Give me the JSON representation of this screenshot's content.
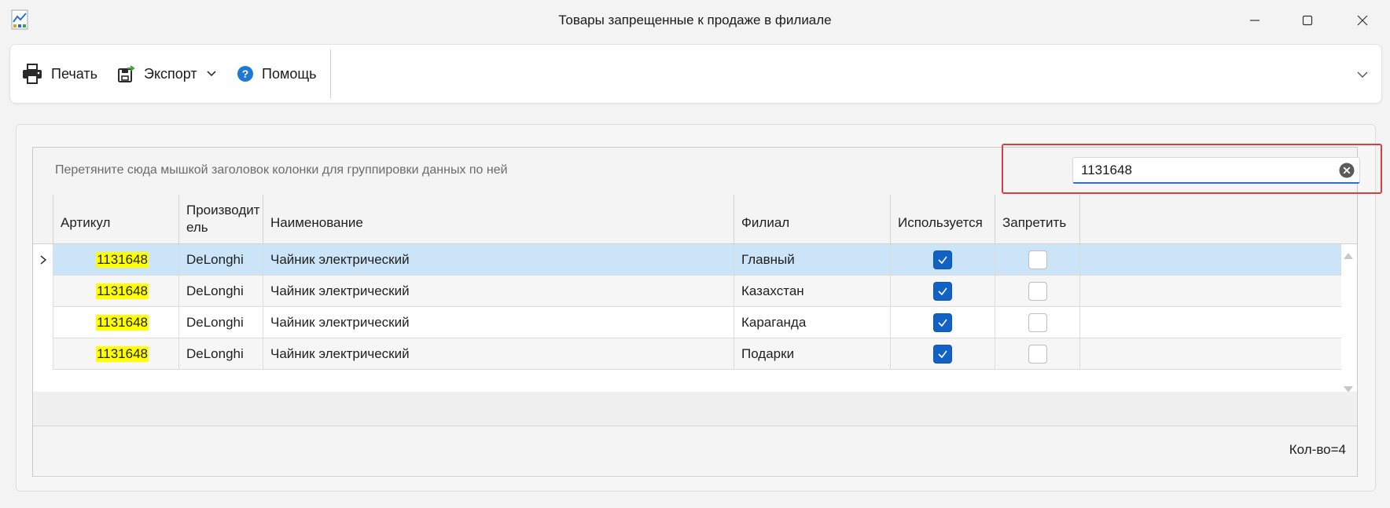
{
  "window": {
    "title": "Товары запрещенные к продаже в филиале"
  },
  "toolbar": {
    "print_label": "Печать",
    "export_label": "Экспорт",
    "help_label": "Помощь"
  },
  "grid": {
    "group_hint": "Перетяните сюда мышкой заголовок колонки для группировки данных по ней",
    "search_value": "1131648",
    "columns": [
      "Артикул",
      "Производит ель",
      "Наименование",
      "Филиал",
      "Используется",
      "Запретить"
    ],
    "rows": [
      {
        "article": "1131648",
        "manufacturer": "DeLonghi",
        "name": "Чайник электрический",
        "branch": "Главный",
        "used": true,
        "forbid": false
      },
      {
        "article": "1131648",
        "manufacturer": "DeLonghi",
        "name": "Чайник электрический",
        "branch": "Казахстан",
        "used": true,
        "forbid": false
      },
      {
        "article": "1131648",
        "manufacturer": "DeLonghi",
        "name": "Чайник электрический",
        "branch": "Караганда",
        "used": true,
        "forbid": false
      },
      {
        "article": "1131648",
        "manufacturer": "DeLonghi",
        "name": "Чайник электрический",
        "branch": "Подарки",
        "used": true,
        "forbid": false
      }
    ],
    "selected_row": 0,
    "count_label": "Кол-во=4"
  },
  "colors": {
    "accent": "#1261c4",
    "highlight": "#ffff00",
    "selection": "#cce4f7",
    "search_outline": "#d64040"
  }
}
